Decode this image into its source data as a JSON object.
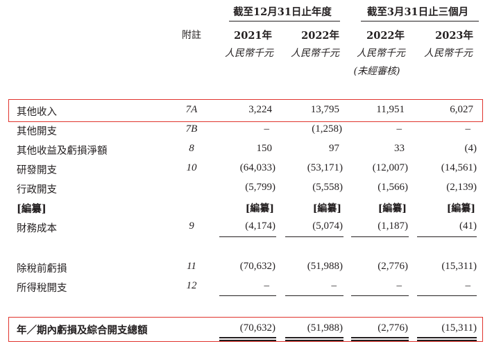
{
  "header": {
    "group1": "截至12月31日止年度",
    "group2": "截至3月31日止三個月",
    "note_label": "附註",
    "years": [
      "2021年",
      "2022年",
      "2022年",
      "2023年"
    ],
    "unit": "人民幣千元",
    "unaudited": "(未經審核)"
  },
  "rows": [
    {
      "label": "其他收入",
      "note": "7A",
      "values": [
        "3,224",
        "13,795",
        "11,951",
        "6,027"
      ]
    },
    {
      "label": "其他開支",
      "note": "7B",
      "values": [
        "–",
        "(1,258)",
        "–",
        "–"
      ]
    },
    {
      "label": "其他收益及虧損淨額",
      "note": "8",
      "values": [
        "150",
        "97",
        "33",
        "(4)"
      ]
    },
    {
      "label": "研發開支",
      "note": "10",
      "values": [
        "(64,033)",
        "(53,171)",
        "(12,007)",
        "(14,561)"
      ]
    },
    {
      "label": "行政開支",
      "note": "",
      "values": [
        "(5,799)",
        "(5,558)",
        "(1,566)",
        "(2,139)"
      ]
    },
    {
      "label": "[編纂]",
      "note": "",
      "values": [
        "[編纂]",
        "[編纂]",
        "[編纂]",
        "[編纂]"
      ]
    },
    {
      "label": "財務成本",
      "note": "9",
      "values": [
        "(4,174)",
        "(5,074)",
        "(1,187)",
        "(41)"
      ]
    },
    {
      "label": "除稅前虧損",
      "note": "11",
      "values": [
        "(70,632)",
        "(51,988)",
        "(2,776)",
        "(15,311)"
      ]
    },
    {
      "label": "所得稅開支",
      "note": "12",
      "values": [
        "–",
        "–",
        "–",
        "–"
      ]
    }
  ],
  "total": {
    "label": "年／期內虧損及綜合開支總額",
    "values": [
      "(70,632)",
      "(51,988)",
      "(2,776)",
      "(15,311)"
    ]
  },
  "colors": {
    "highlight_box": "#e0332c",
    "text": "#231f20"
  }
}
